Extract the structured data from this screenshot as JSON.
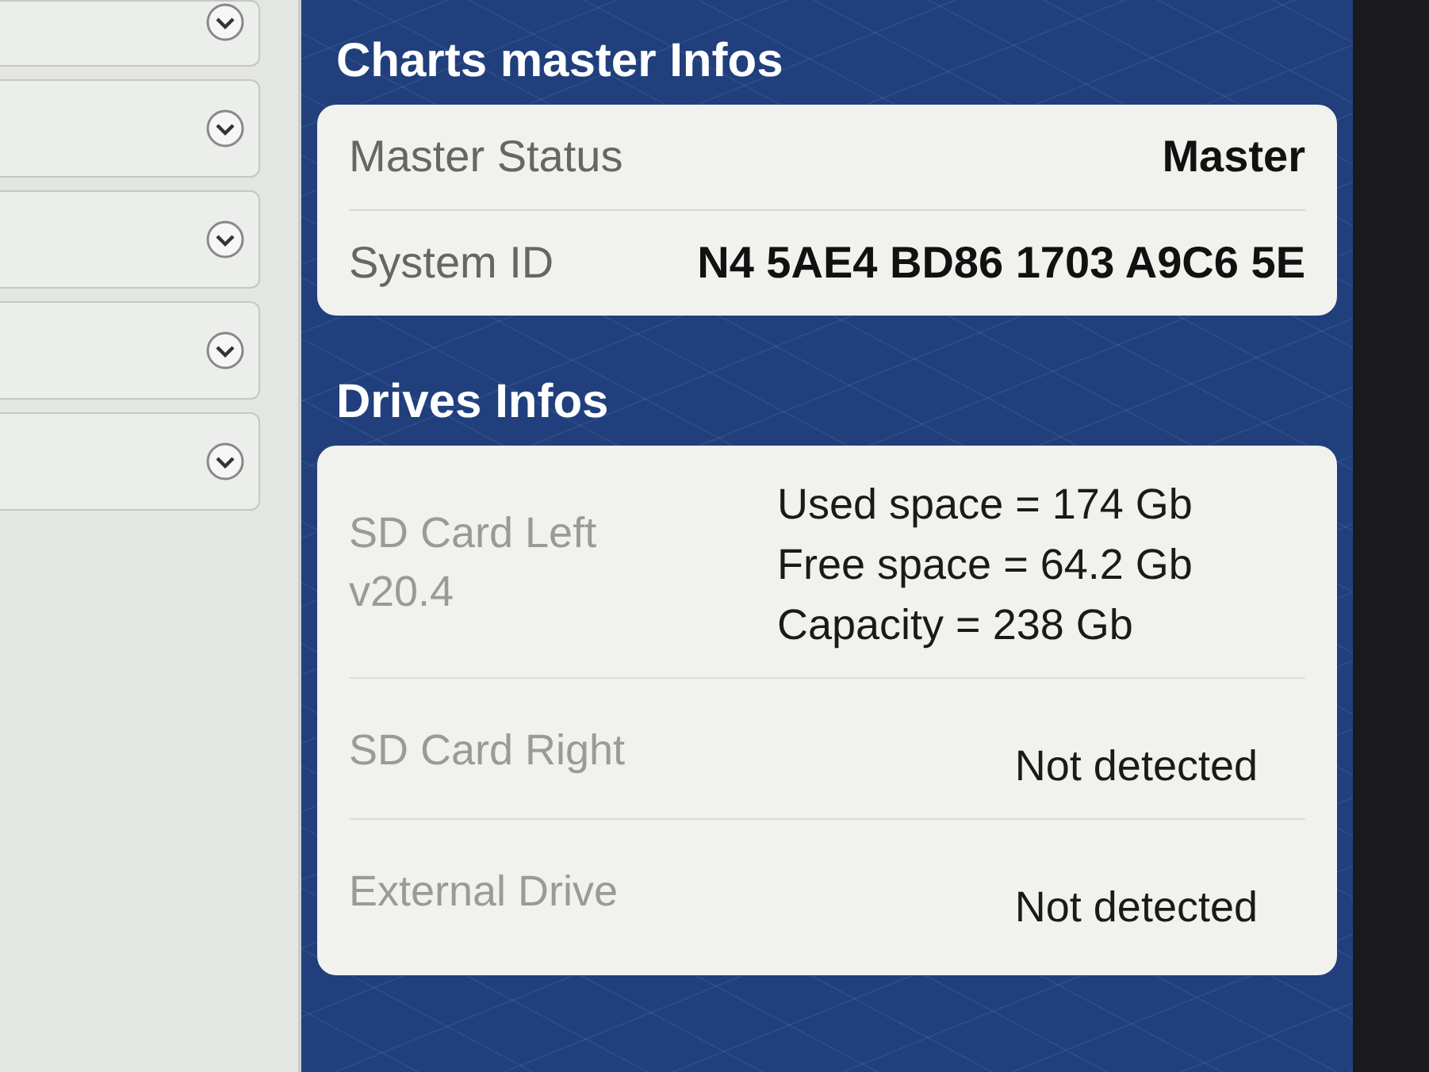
{
  "left_panel": {
    "rows": [
      {
        "expanded": false
      },
      {
        "expanded": false
      },
      {
        "expanded": false
      },
      {
        "expanded": false
      },
      {
        "expanded": false
      }
    ]
  },
  "master_infos": {
    "title": "Charts master Infos",
    "rows": [
      {
        "label": "Master Status",
        "value": "Master"
      },
      {
        "label": "System ID",
        "value": "N4 5AE4 BD86 1703 A9C6 5E"
      }
    ]
  },
  "drives_infos": {
    "title": "Drives Infos",
    "drives": [
      {
        "name": "SD Card Left",
        "version": "v20.4",
        "details": [
          "Used space = 174 Gb",
          "Free space = 64.2 Gb",
          "Capacity = 238 Gb"
        ]
      },
      {
        "name": "SD Card Right",
        "details": [
          "Not detected"
        ]
      },
      {
        "name": "External Drive",
        "details": [
          "Not detected"
        ]
      }
    ]
  }
}
